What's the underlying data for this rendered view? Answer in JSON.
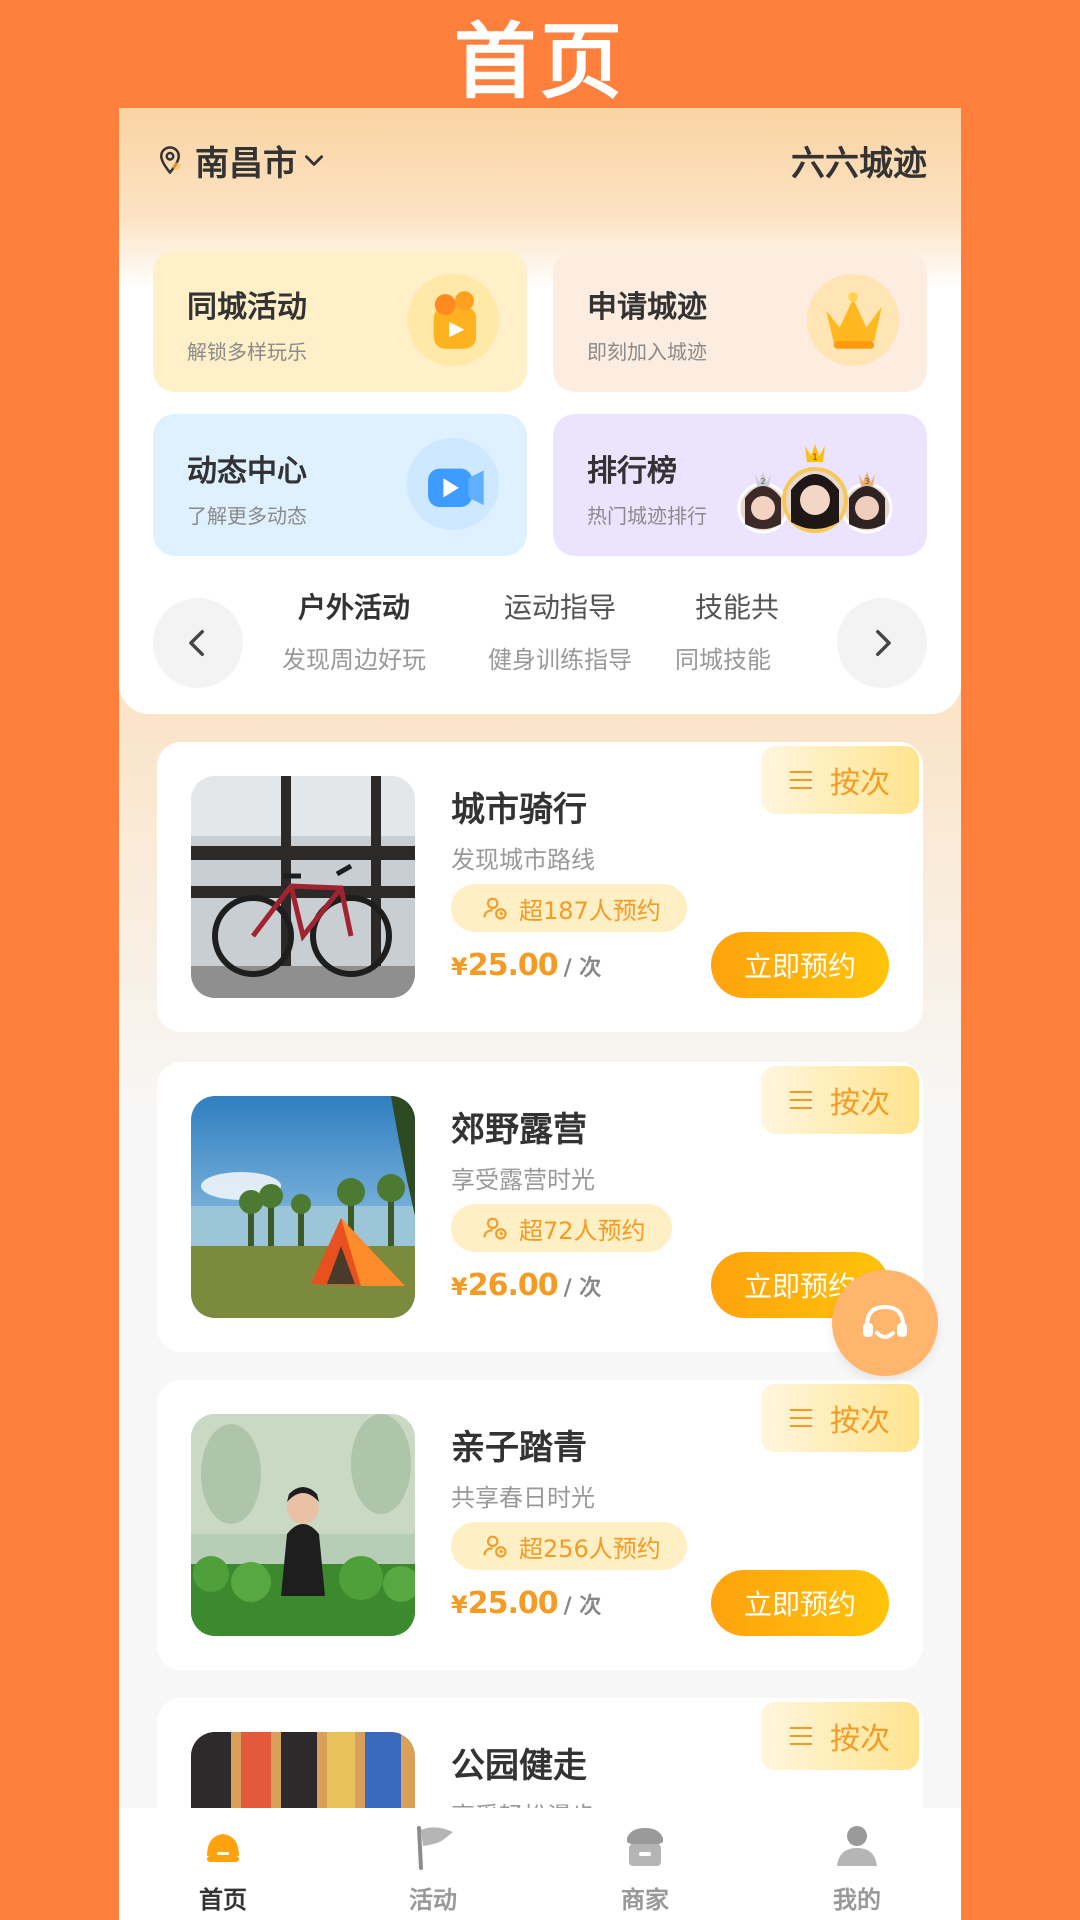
{
  "header": {
    "title": "首页"
  },
  "location": {
    "city": "南昌市"
  },
  "brand": "六六城迹",
  "features": [
    {
      "title": "同城活动",
      "subtitle": "解锁多样玩乐",
      "icon": "ticket-icon"
    },
    {
      "title": "申请城迹",
      "subtitle": "即刻加入城迹",
      "icon": "crown-icon"
    },
    {
      "title": "动态中心",
      "subtitle": "了解更多动态",
      "icon": "video-icon"
    },
    {
      "title": "排行榜",
      "subtitle": "热门城迹排行",
      "icon": "ranking-avatars",
      "ranks": [
        "1",
        "2",
        "3"
      ]
    }
  ],
  "categories": [
    {
      "title": "户外活动",
      "subtitle": "发现周边好玩",
      "active": true
    },
    {
      "title": "运动指导",
      "subtitle": "健身训练指导"
    },
    {
      "title": "技能共",
      "subtitle": "同城技能"
    }
  ],
  "activities": [
    {
      "title": "城市骑行",
      "subtitle": "发现城市路线",
      "booked": "超187人预约",
      "currency": "¥",
      "price": "25.00",
      "unit": "/ 次",
      "book_label": "立即预约",
      "tag": "按次"
    },
    {
      "title": "郊野露营",
      "subtitle": "享受露营时光",
      "booked": "超72人预约",
      "currency": "¥",
      "price": "26.00",
      "unit": "/ 次",
      "book_label": "立即预约",
      "tag": "按次"
    },
    {
      "title": "亲子踏青",
      "subtitle": "共享春日时光",
      "booked": "超256人预约",
      "currency": "¥",
      "price": "25.00",
      "unit": "/ 次",
      "book_label": "立即预约",
      "tag": "按次"
    },
    {
      "title": "公园健走",
      "subtitle": "享受轻松漫步",
      "tag": "按次"
    }
  ],
  "tabbar": [
    {
      "label": "首页",
      "icon": "home-icon",
      "active": true
    },
    {
      "label": "活动",
      "icon": "flag-icon"
    },
    {
      "label": "商家",
      "icon": "store-icon"
    },
    {
      "label": "我的",
      "icon": "user-icon"
    }
  ],
  "colors": {
    "background": "#FF7F3D",
    "accent": "#F59A23",
    "button": "#FFA20E"
  }
}
